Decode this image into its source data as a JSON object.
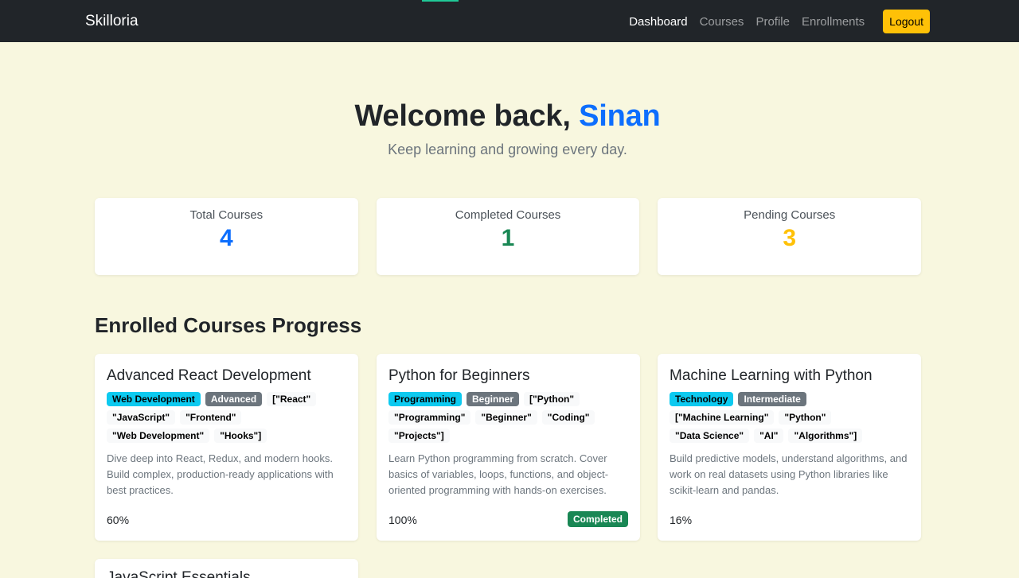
{
  "navbar": {
    "brand": "Skilloria",
    "links": [
      "Dashboard",
      "Courses",
      "Profile",
      "Enrollments"
    ],
    "logout_label": "Logout"
  },
  "hero": {
    "greeting": "Welcome back, ",
    "user_name": "Sinan",
    "subtitle": "Keep learning and growing every day."
  },
  "stats": [
    {
      "label": "Total Courses",
      "value": "4",
      "color": "#0d6efd"
    },
    {
      "label": "Completed Courses",
      "value": "1",
      "color": "#198754"
    },
    {
      "label": "Pending Courses",
      "value": "3",
      "color": "#ffc107"
    }
  ],
  "section_title": "Enrolled Courses Progress",
  "courses": [
    {
      "title": "Advanced React Development",
      "category": "Web Development",
      "level": "Advanced",
      "keywords": [
        "[\"React\"",
        "\"JavaScript\"",
        "\"Frontend\"",
        "\"Web Development\"",
        "\"Hooks\"]"
      ],
      "description": "Dive deep into React, Redux, and modern hooks. Build complex, production-ready applications with best practices.",
      "progress": "60%",
      "status": ""
    },
    {
      "title": "Python for Beginners",
      "category": "Programming",
      "level": "Beginner",
      "keywords": [
        "[\"Python\"",
        "\"Programming\"",
        "\"Beginner\"",
        "\"Coding\"",
        "\"Projects\"]"
      ],
      "description": "Learn Python programming from scratch. Cover basics of variables, loops, functions, and object-oriented programming with hands-on exercises.",
      "progress": "100%",
      "status": "Completed"
    },
    {
      "title": "Machine Learning with Python",
      "category": "Technology",
      "level": "Intermediate",
      "keywords": [
        "[\"Machine Learning\"",
        "\"Python\"",
        "\"Data Science\"",
        "\"AI\"",
        "\"Algorithms\"]"
      ],
      "description": "Build predictive models, understand algorithms, and work on real datasets using Python libraries like scikit-learn and pandas.",
      "progress": "16%",
      "status": ""
    }
  ],
  "partial_course_title": "JavaScript Essentials"
}
